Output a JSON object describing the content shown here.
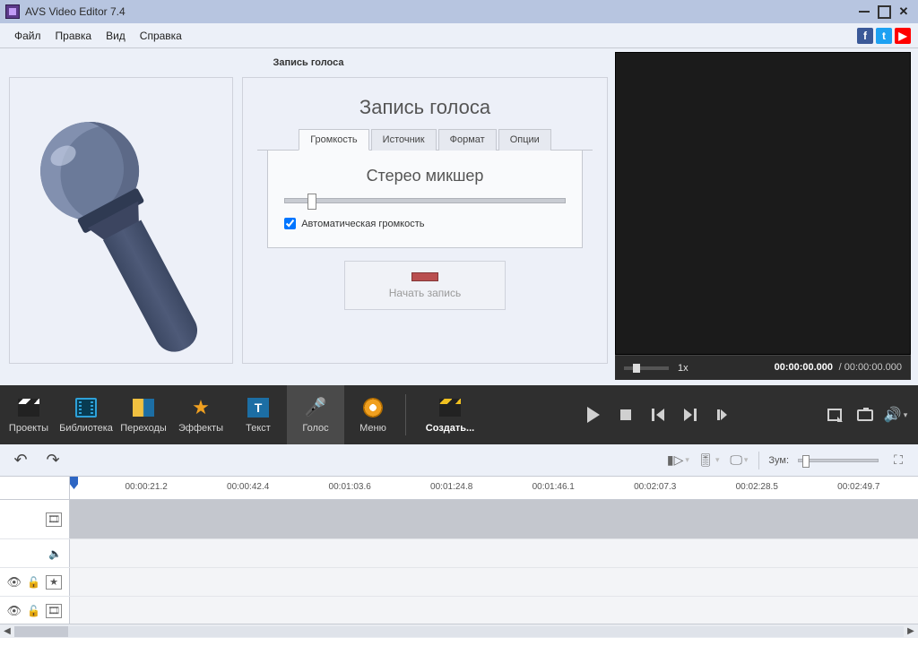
{
  "titlebar": {
    "title": "AVS Video Editor 7.4"
  },
  "menubar": {
    "items": [
      "Файл",
      "Правка",
      "Вид",
      "Справка"
    ]
  },
  "panel": {
    "header": "Запись голоса",
    "voice_title": "Запись голоса",
    "tabs": [
      "Громкость",
      "Источник",
      "Формат",
      "Опции"
    ],
    "device": "Стерео микшер",
    "auto_volume": "Автоматическая громкость",
    "record": "Начать запись"
  },
  "preview": {
    "speed": "1x",
    "time_current": "00:00:00.000",
    "time_total": "00:00:00.000"
  },
  "toolbar": {
    "projects": "Проекты",
    "library": "Библиотека",
    "transitions": "Переходы",
    "effects": "Эффекты",
    "text": "Текст",
    "voice": "Голос",
    "menu": "Меню",
    "create": "Создать..."
  },
  "tl_toolbar": {
    "zoom_label": "Зум:"
  },
  "ruler": {
    "ticks": [
      "00:00:21.2",
      "00:00:42.4",
      "00:01:03.6",
      "00:01:24.8",
      "00:01:46.1",
      "00:02:07.3",
      "00:02:28.5",
      "00:02:49.7"
    ]
  }
}
